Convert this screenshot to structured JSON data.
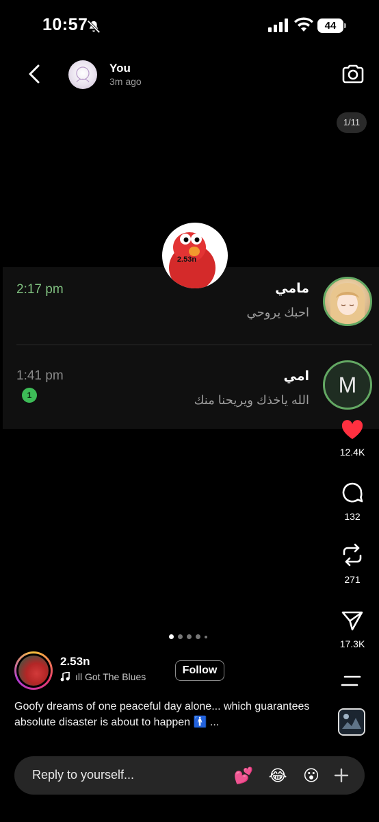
{
  "status_bar": {
    "time": "10:57",
    "battery": "44"
  },
  "header": {
    "name": "You",
    "time_ago": "3m ago",
    "counter": "1/11"
  },
  "sticker": {
    "text": "2.53n"
  },
  "chat_card": {
    "rows": [
      {
        "time": "2:17 pm",
        "name": "مامي",
        "message": "احبك يروحي",
        "avatar_letter": ""
      },
      {
        "time": "1:41 pm",
        "name": "امي",
        "message": "الله ياخذك ويريحنا منك",
        "avatar_letter": "M",
        "unread": "1"
      }
    ]
  },
  "actions": {
    "likes": "12.4K",
    "comments": "132",
    "reposts": "271",
    "shares": "17.3K"
  },
  "author": {
    "name": "2.53n",
    "follow_label": "Follow",
    "song": "ıll Got The Blues",
    "caption": "Goofy dreams of one peaceful day alone... which guarantees absolute disaster is about to happen 🚹 ..."
  },
  "reply": {
    "placeholder": "Reply to yourself...",
    "emojis": [
      "💕",
      "😂",
      "😮"
    ]
  },
  "colors": {
    "like_red": "#ff3040",
    "online_green": "#63a863",
    "badge_green": "#3dbb57"
  }
}
